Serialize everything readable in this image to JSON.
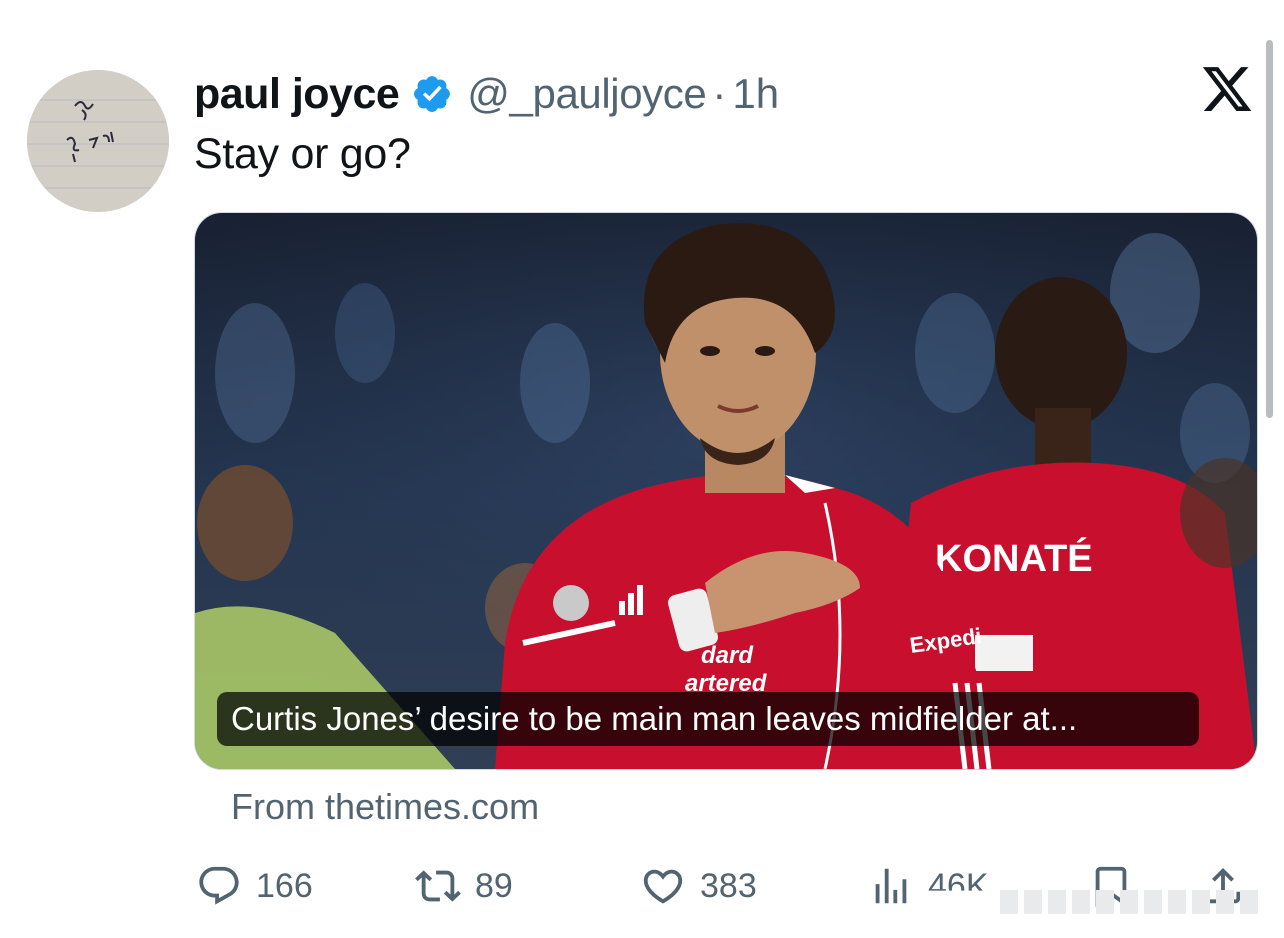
{
  "author": {
    "name": "paul joyce",
    "handle": "@_pauljoyce",
    "separator": "·",
    "time": "1h",
    "verified": true,
    "avatar_icon": "handwritten-note-avatar"
  },
  "platform_icon": "x-logo-icon",
  "tweet": {
    "text": "Stay or go?"
  },
  "card": {
    "title": "Curtis Jones’ desire to be main man leaves midfielder at...",
    "source": "From thetimes.com",
    "image_description_icon": "footballer-photo",
    "shirt_text_1": "KONATÉ",
    "shirt_text_2": "dard",
    "shirt_text_3": "artered",
    "shirt_text_4": "Expedi"
  },
  "actions": {
    "replies": "166",
    "reposts": "89",
    "likes": "383",
    "views": "46K"
  },
  "colors": {
    "text": "#0f1419",
    "secondary": "#536471",
    "verified": "#1d9bf0",
    "jersey": "#c8102e"
  }
}
